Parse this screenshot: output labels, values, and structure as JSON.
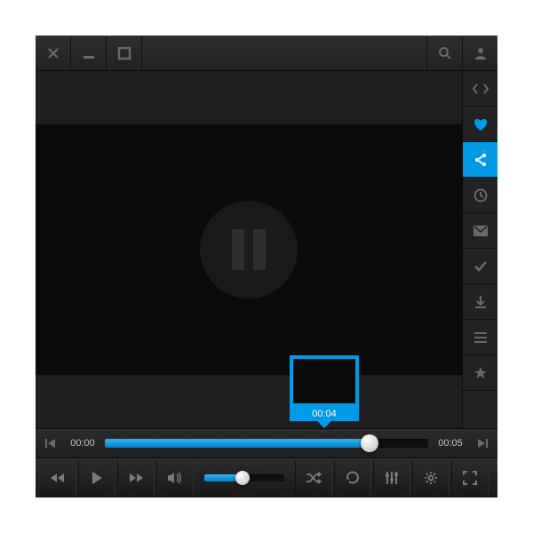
{
  "progress": {
    "current": "00:00",
    "duration": "00:05",
    "preview_time": "00:04",
    "played_percent": 82
  },
  "volume": {
    "percent": 48
  },
  "colors": {
    "accent": "#0099e5",
    "bg_dark": "#1a1a1a",
    "bg_video": "#0b0b0b"
  },
  "sidebar": {
    "items": [
      {
        "name": "embed",
        "active": false
      },
      {
        "name": "favorite",
        "active": false,
        "highlighted": true
      },
      {
        "name": "share",
        "active": true
      },
      {
        "name": "watch-later",
        "active": false
      },
      {
        "name": "mail",
        "active": false
      },
      {
        "name": "check",
        "active": false
      },
      {
        "name": "download",
        "active": false
      },
      {
        "name": "list",
        "active": false
      },
      {
        "name": "star",
        "active": false
      }
    ]
  }
}
